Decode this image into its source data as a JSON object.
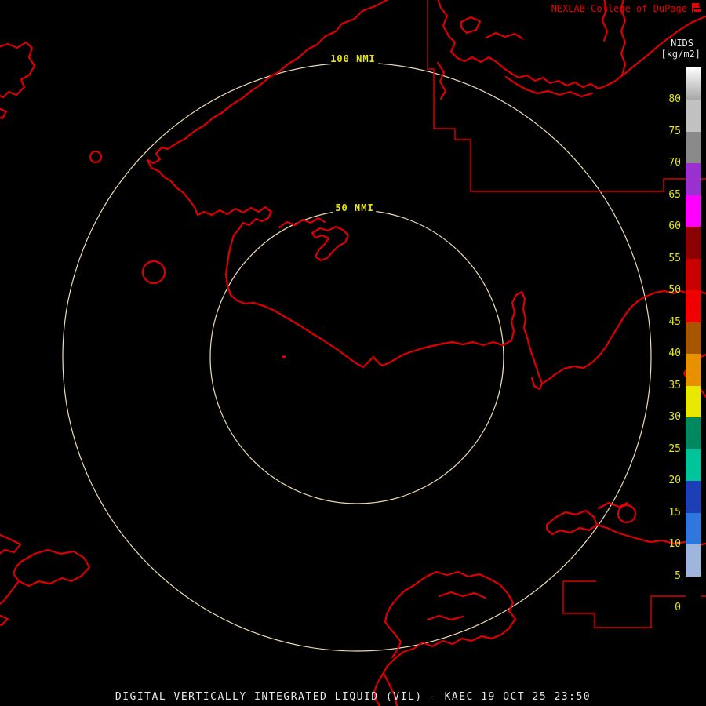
{
  "header": {
    "credit": "NEXLAB-College of DuPage"
  },
  "colorbar": {
    "title": "NIDS",
    "units": "[kg/m2]",
    "tick_values": [
      80,
      75,
      70,
      65,
      60,
      55,
      50,
      45,
      40,
      35,
      30,
      25,
      20,
      15,
      10,
      5,
      0
    ],
    "cap": {
      "from": "#FFFFFF",
      "to": "#A8A8A8"
    },
    "segments_top_to_bottom": [
      {
        "range": "75-80",
        "color": "#C2C2C2"
      },
      {
        "range": "70-75",
        "color": "#8A8A8A"
      },
      {
        "range": "65-70",
        "color": "#9B30D0"
      },
      {
        "range": "60-65",
        "color": "#FF00FF"
      },
      {
        "range": "55-60",
        "color": "#8B0000"
      },
      {
        "range": "50-55",
        "color": "#C80000"
      },
      {
        "range": "45-50",
        "color": "#F00000"
      },
      {
        "range": "40-45",
        "color": "#A85400"
      },
      {
        "range": "35-40",
        "color": "#E89000"
      },
      {
        "range": "30-35",
        "color": "#E8E800"
      },
      {
        "range": "25-30",
        "color": "#00885E"
      },
      {
        "range": "20-25",
        "color": "#00C49A"
      },
      {
        "range": "15-20",
        "color": "#1C3FB8"
      },
      {
        "range": "10-15",
        "color": "#2E77DE"
      },
      {
        "range": "5-10",
        "color": "#9EB6DC"
      },
      {
        "range": "0-5",
        "color": "#000000"
      }
    ]
  },
  "rings": {
    "outer_label": "100 NMI",
    "inner_label": "50 NMI"
  },
  "footer": {
    "caption": "DIGITAL VERTICALLY INTEGRATED LIQUID (VIL) - KAEC 19 OCT 25 23:50"
  },
  "colors": {
    "background": "#000000",
    "map_outline": "#DC0000",
    "range_ring": "#F0DCB4",
    "label_yellow": "#E8E800",
    "credit_red": "#E80000",
    "text_white": "#E8E8E8"
  }
}
